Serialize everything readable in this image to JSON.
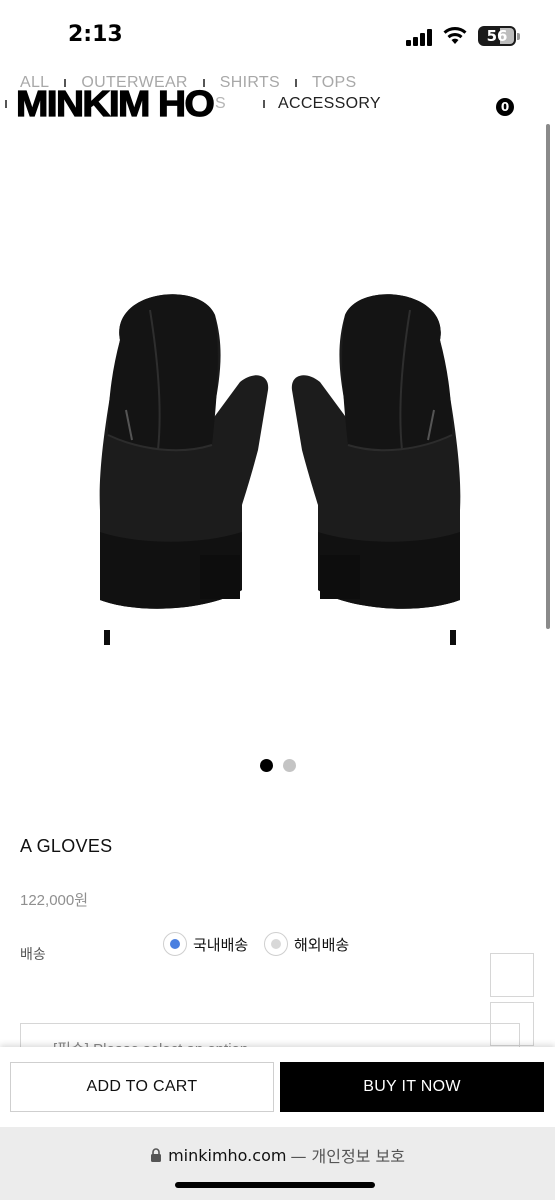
{
  "status_bar": {
    "time": "2:13",
    "battery": "56"
  },
  "nav": {
    "top_links": [
      "ALL",
      "OUTERWEAR",
      "SHIRTS",
      "TOPS"
    ],
    "partial_link": "S",
    "active_link": "ACCESSORY"
  },
  "brand": {
    "logo": "MINKIM HO"
  },
  "cart": {
    "count": "0"
  },
  "product": {
    "name": "A GLOVES",
    "price": "122,000원",
    "image_icon": "mitten-gloves-image",
    "slides": {
      "current": 1,
      "total": 2
    }
  },
  "shipping": {
    "label": "배송",
    "options": [
      {
        "label": "국내배송",
        "selected": true
      },
      {
        "label": "해외배송",
        "selected": false
      }
    ]
  },
  "option_select": {
    "text": "[필수] Please select an option"
  },
  "actions": {
    "add_to_cart": "ADD TO CART",
    "buy_now": "BUY IT NOW"
  },
  "browser": {
    "domain": "minkimho.com",
    "privacy": "— 개인정보 보호"
  },
  "colors": {
    "accent_radio": "#4a7fe0",
    "buy_button": "#000000"
  }
}
